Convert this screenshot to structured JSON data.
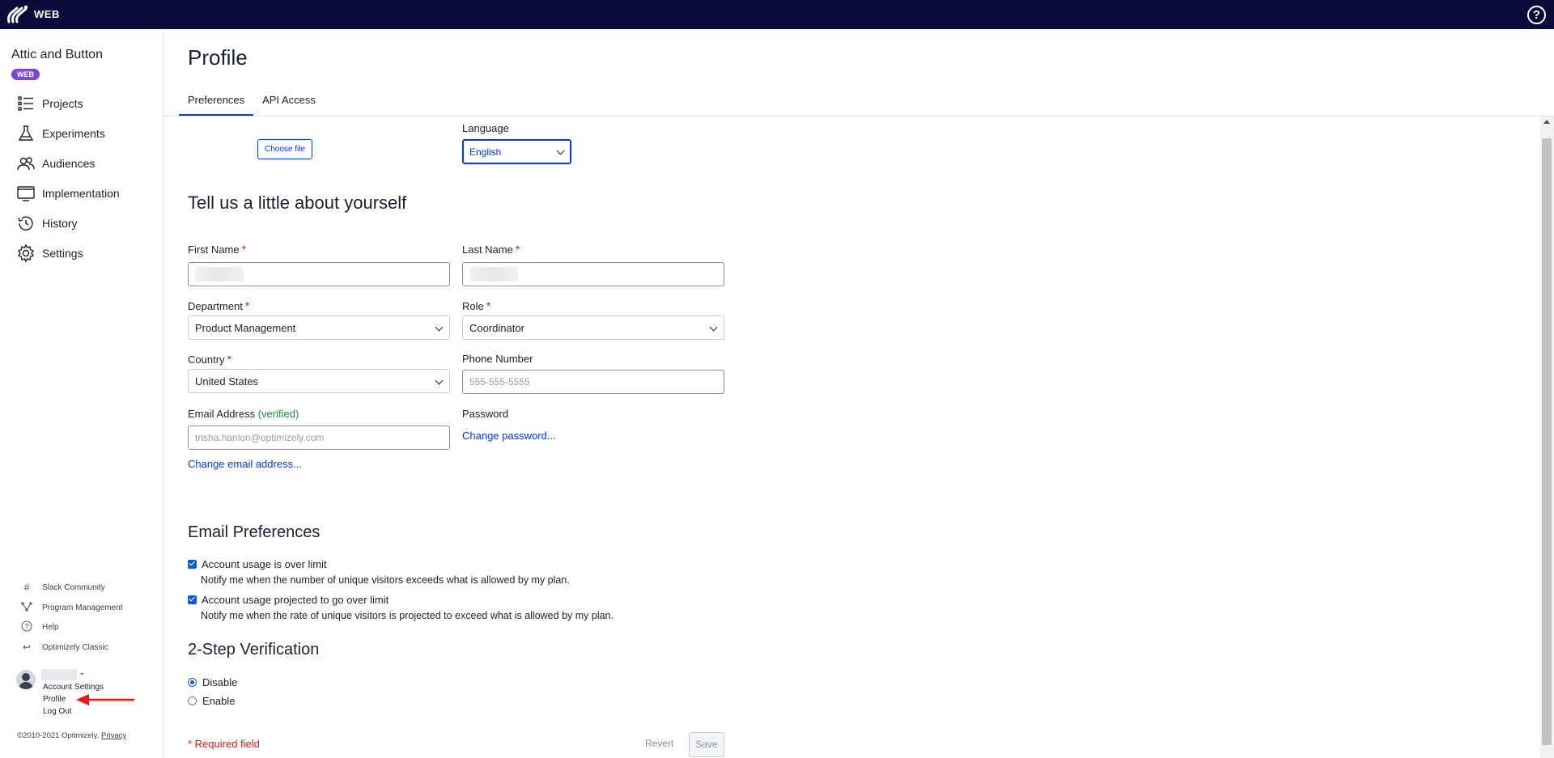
{
  "topbar": {
    "brand": "WEB",
    "help_glyph": "?"
  },
  "sidebar": {
    "account_name": "Attic and Button",
    "account_badge": "WEB",
    "nav": [
      {
        "label": "Projects",
        "icon": "projects-icon"
      },
      {
        "label": "Experiments",
        "icon": "flask-icon"
      },
      {
        "label": "Audiences",
        "icon": "audiences-icon"
      },
      {
        "label": "Implementation",
        "icon": "implementation-icon"
      },
      {
        "label": "History",
        "icon": "history-icon"
      },
      {
        "label": "Settings",
        "icon": "gear-icon"
      }
    ],
    "footer": [
      {
        "label": "Slack Community",
        "icon": "hash-icon"
      },
      {
        "label": "Program Management",
        "icon": "program-icon"
      },
      {
        "label": "Help",
        "icon": "help-icon"
      },
      {
        "label": "Optimizely Classic",
        "icon": "return-icon"
      }
    ],
    "user_menu": {
      "account_settings": "Account Settings",
      "profile": "Profile",
      "logout": "Log Out"
    },
    "copyright": "©2010-2021 Optimizely.",
    "privacy": "Privacy"
  },
  "page": {
    "title": "Profile",
    "tabs": [
      "Preferences",
      "API Access"
    ],
    "active_tab": "Preferences"
  },
  "form": {
    "choose_file": "Choose file",
    "language_label": "Language",
    "language_value": "English",
    "about_heading": "Tell us a little about yourself",
    "first_name_label": "First Name",
    "last_name_label": "Last Name",
    "required_mark": "*",
    "department_label": "Department",
    "department_value": "Product Management",
    "role_label": "Role",
    "role_value": "Coordinator",
    "country_label": "Country",
    "country_value": "United States",
    "phone_label": "Phone Number",
    "phone_placeholder": "555-555-5555",
    "email_label": "Email Address",
    "email_verified": "(verified)",
    "email_placeholder": "trisha.hanlon@optimizely.com",
    "password_label": "Password",
    "change_password": "Change password...",
    "change_email": "Change email address..."
  },
  "email_prefs": {
    "heading": "Email Preferences",
    "items": [
      {
        "title": "Account usage is over limit",
        "desc": "Notify me when the number of unique visitors exceeds what is allowed by my plan.",
        "checked": true
      },
      {
        "title": "Account usage projected to go over limit",
        "desc": "Notify me when the rate of unique visitors is projected to exceed what is allowed by my plan.",
        "checked": true
      }
    ]
  },
  "two_step": {
    "heading": "2-Step Verification",
    "options": [
      "Disable",
      "Enable"
    ],
    "selected": "Disable"
  },
  "footer": {
    "required_note": "* Required field",
    "revert": "Revert",
    "save": "Save"
  },
  "colors": {
    "topbar": "#0b0b3b",
    "accent": "#0037ff",
    "badge": "#7b48d4",
    "required": "#e61919",
    "verified": "#1e8f3a",
    "annotation_arrow": "#e61919"
  }
}
